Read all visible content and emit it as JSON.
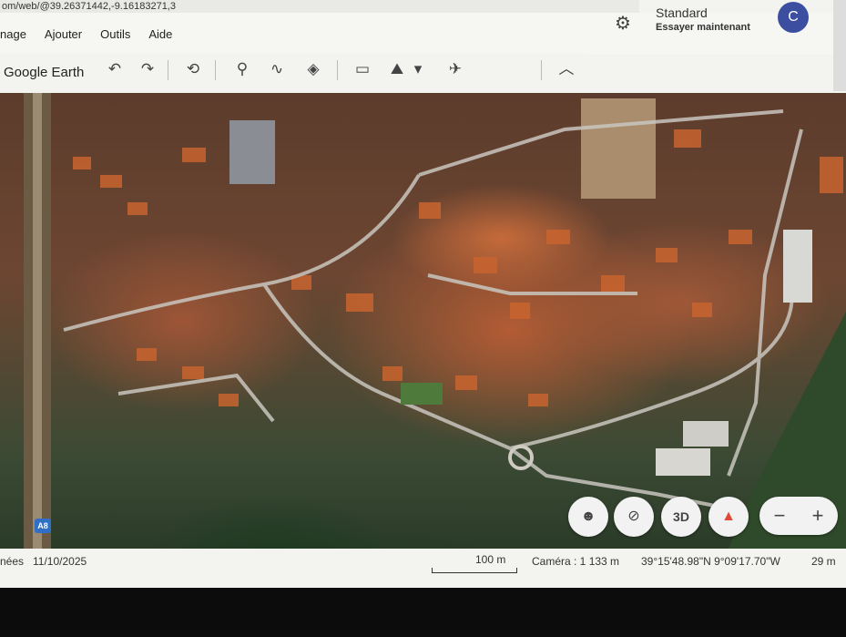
{
  "browser": {
    "url_fragment": "om/web/@39.26371442,-9.16183271,3"
  },
  "menu": {
    "items": [
      "nage",
      "Ajouter",
      "Outils",
      "Aide"
    ]
  },
  "profile": {
    "mode": "Standard",
    "subtitle": "Essayer maintenant",
    "avatar_letter": "C"
  },
  "toolbar": {
    "brand": "Google Earth",
    "icons": [
      "undo-icon",
      "redo-icon",
      "history-icon",
      "placemark-icon",
      "path-icon",
      "layers-icon",
      "ruler-icon",
      "elevation-icon",
      "dropdown-icon",
      "satellite-icon",
      "collapse-icon"
    ]
  },
  "map": {
    "road_shield": "A8",
    "controls": {
      "street_view": "pegman-icon",
      "location": "location-off-icon",
      "three_d": "3D",
      "compass": "compass-icon",
      "zoom_out": "−",
      "zoom_in": "+"
    }
  },
  "status": {
    "left_label": "nées",
    "date": "11/10/2025",
    "scale": "100 m",
    "camera": "Caméra : 1 133 m",
    "coords": "39°15'48.98\"N 9°09'17.70\"W",
    "elevation": "29 m"
  },
  "colors": {
    "avatar": "#3c4ea0",
    "shield": "#2f6fc6",
    "compass_red": "#e04a36"
  }
}
